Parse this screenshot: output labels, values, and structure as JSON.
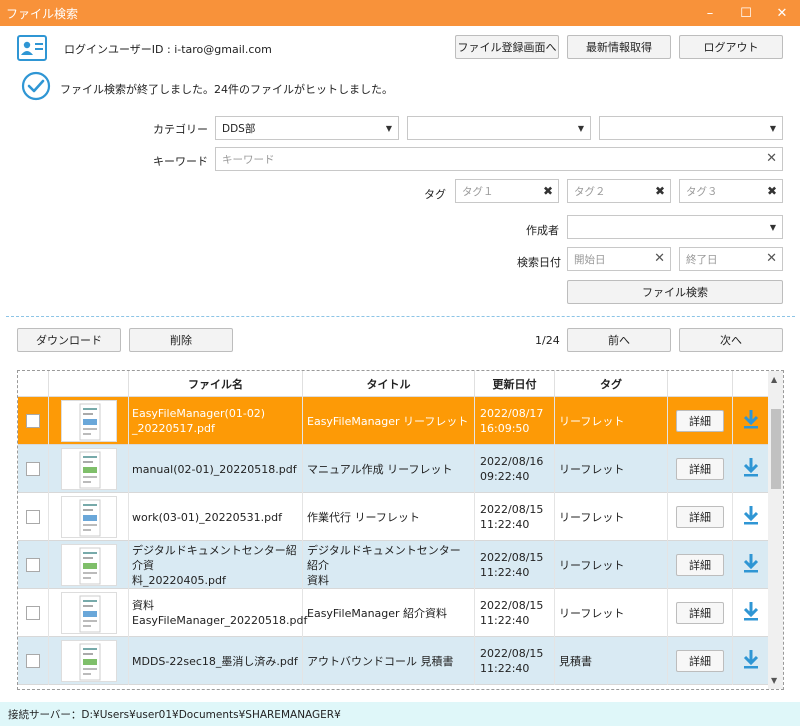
{
  "window": {
    "title": "ファイル検索"
  },
  "header": {
    "login_user": "ログインユーザーID : i-taro@gmail.com",
    "buttons": {
      "register": "ファイル登録画面へ",
      "refresh": "最新情報取得",
      "logout": "ログアウト"
    }
  },
  "message": "ファイル検索が終了しました。24件のファイルがヒットしました。",
  "search": {
    "category_label": "カテゴリー",
    "category_value": "DDS部",
    "keyword_label": "キーワード",
    "keyword_placeholder": "キーワード",
    "tag_label": "タグ",
    "tag1_placeholder": "タグ１",
    "tag2_placeholder": "タグ２",
    "tag3_placeholder": "タグ３",
    "author_label": "作成者",
    "date_label": "検索日付",
    "start_placeholder": "開始日",
    "end_placeholder": "終了日",
    "search_button": "ファイル検索"
  },
  "actions": {
    "download": "ダウンロード",
    "delete": "削除",
    "page": "1/24",
    "prev": "前へ",
    "next": "次へ"
  },
  "table": {
    "headers": {
      "filename": "ファイル名",
      "title": "タイトル",
      "updated": "更新日付",
      "tag": "タグ"
    },
    "detail_label": "詳細",
    "rows": [
      {
        "file1": "EasyFileManager(01-02)",
        "file2": "_20220517.pdf",
        "title1": "EasyFileManager リーフレット",
        "title2": "",
        "date": "2022/08/17",
        "time": "16:09:50",
        "tag": "リーフレット",
        "selected": true
      },
      {
        "file1": "manual(02-01)_20220518.pdf",
        "file2": "",
        "title1": "マニュアル作成 リーフレット",
        "title2": "",
        "date": "2022/08/16",
        "time": "09:22:40",
        "tag": "リーフレット",
        "selected": false
      },
      {
        "file1": "work(03-01)_20220531.pdf",
        "file2": "",
        "title1": "作業代行 リーフレット",
        "title2": "",
        "date": "2022/08/15",
        "time": "11:22:40",
        "tag": "リーフレット",
        "selected": false
      },
      {
        "file1": "デジタルドキュメントセンター紹介資",
        "file2": "料_20220405.pdf",
        "title1": "デジタルドキュメントセンター 紹介",
        "title2": "資料",
        "date": "2022/08/15",
        "time": "11:22:40",
        "tag": "リーフレット",
        "selected": false
      },
      {
        "file1": "資料",
        "file2": "EasyFileManager_20220518.pdf",
        "title1": "EasyFileManager 紹介資料",
        "title2": "",
        "date": "2022/08/15",
        "time": "11:22:40",
        "tag": "リーフレット",
        "selected": false
      },
      {
        "file1": "MDDS-22sec18_墨消し済み.pdf",
        "file2": "",
        "title1": "アウトバウンドコール 見積書",
        "title2": "",
        "date": "2022/08/15",
        "time": "11:22:40",
        "tag": "見積書",
        "selected": false
      }
    ]
  },
  "status": "接続サーバー：D:¥Users¥user01¥Documents¥SHAREMANAGER¥",
  "colors": {
    "titlebar": "#f8923a",
    "selected_row": "#fd9a06",
    "alt_row": "#d9eaf3",
    "accent": "#2f96d4",
    "status_bg": "#dff7f9"
  }
}
